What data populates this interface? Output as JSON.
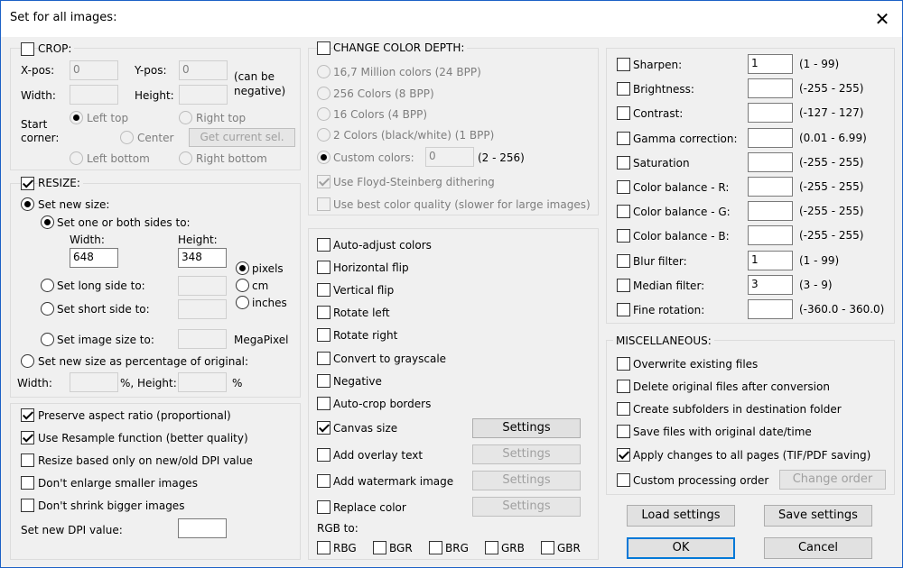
{
  "title": "Set for all images:",
  "crop": {
    "label": "CROP:",
    "xpos_label": "X-pos:",
    "xpos": "0",
    "ypos_label": "Y-pos:",
    "ypos": "0",
    "neg_note": "(can be negative)",
    "width_label": "Width:",
    "height_label": "Height:",
    "start_corner": "Start corner:",
    "left_top": "Left top",
    "right_top": "Right top",
    "center": "Center",
    "left_bottom": "Left bottom",
    "right_bottom": "Right bottom",
    "get_current": "Get current sel."
  },
  "resize": {
    "label": "RESIZE:",
    "set_new_size": "Set new size:",
    "set_one_or_both": "Set one or both sides to:",
    "width_label": "Width:",
    "width": "648",
    "height_label": "Height:",
    "height": "348",
    "pixels": "pixels",
    "cm": "cm",
    "inches": "inches",
    "long_side": "Set long side to:",
    "short_side": "Set short side to:",
    "image_size": "Set image size to:",
    "megapixel": "MegaPixel",
    "percentage": "Set new size as percentage of original:",
    "pct_width": "Width:",
    "pct_height": "%, Height:",
    "pct_sign": "%"
  },
  "options": {
    "preserve": "Preserve aspect ratio (proportional)",
    "resample": "Use Resample function (better quality)",
    "dpi_only": "Resize based only on new/old DPI value",
    "dont_enlarge": "Don't enlarge smaller images",
    "dont_shrink": "Don't shrink bigger images",
    "dpi_label": "Set new DPI value:"
  },
  "color_depth": {
    "label": "CHANGE COLOR DEPTH:",
    "million": "16,7 Million colors (24 BPP)",
    "c256": "256 Colors (8 BPP)",
    "c16": "16 Colors (4 BPP)",
    "c2": "2 Colors (black/white) (1 BPP)",
    "custom": "Custom colors:",
    "custom_value": "0",
    "custom_range": "(2 - 256)",
    "floyd": "Use Floyd-Steinberg dithering",
    "best": "Use best color quality (slower for large images)"
  },
  "transforms": {
    "auto_adjust": "Auto-adjust colors",
    "hflip": "Horizontal flip",
    "vflip": "Vertical flip",
    "rot_left": "Rotate left",
    "rot_right": "Rotate right",
    "grayscale": "Convert to grayscale",
    "negative": "Negative",
    "autocrop": "Auto-crop borders",
    "canvas": "Canvas size",
    "overlay": "Add overlay text",
    "watermark": "Add watermark image",
    "replace": "Replace color",
    "settings": "Settings",
    "rgb_to": "RGB to:",
    "rbg": "RBG",
    "bgr": "BGR",
    "brg": "BRG",
    "grb": "GRB",
    "gbr": "GBR"
  },
  "adjust": {
    "sharpen": {
      "label": "Sharpen:",
      "value": "1",
      "range": "(1 - 99)"
    },
    "brightness": {
      "label": "Brightness:",
      "value": "",
      "range": "(-255 - 255)"
    },
    "contrast": {
      "label": "Contrast:",
      "value": "",
      "range": "(-127 - 127)"
    },
    "gamma": {
      "label": "Gamma correction:",
      "value": "",
      "range": "(0.01 - 6.99)"
    },
    "saturation": {
      "label": "Saturation",
      "value": "",
      "range": "(-255 - 255)"
    },
    "cb_r": {
      "label": "Color balance - R:",
      "value": "",
      "range": "(-255 - 255)"
    },
    "cb_g": {
      "label": "Color balance - G:",
      "value": "",
      "range": "(-255 - 255)"
    },
    "cb_b": {
      "label": "Color balance - B:",
      "value": "",
      "range": "(-255 - 255)"
    },
    "blur": {
      "label": "Blur filter:",
      "value": "1",
      "range": "(1 - 99)"
    },
    "median": {
      "label": "Median filter:",
      "value": "3",
      "range": "(3 - 9)"
    },
    "fine_rot": {
      "label": "Fine rotation:",
      "value": "",
      "range": "(-360.0 - 360.0)"
    }
  },
  "misc": {
    "label": "MISCELLANEOUS:",
    "overwrite": "Overwrite existing files",
    "delete": "Delete original files after conversion",
    "subfolders": "Create subfolders in destination folder",
    "date": "Save files with original date/time",
    "apply_all": "Apply changes to all pages (TIF/PDF saving)",
    "custom_order": "Custom processing order",
    "change_order": "Change order"
  },
  "buttons": {
    "load": "Load settings",
    "save": "Save settings",
    "ok": "OK",
    "cancel": "Cancel"
  }
}
